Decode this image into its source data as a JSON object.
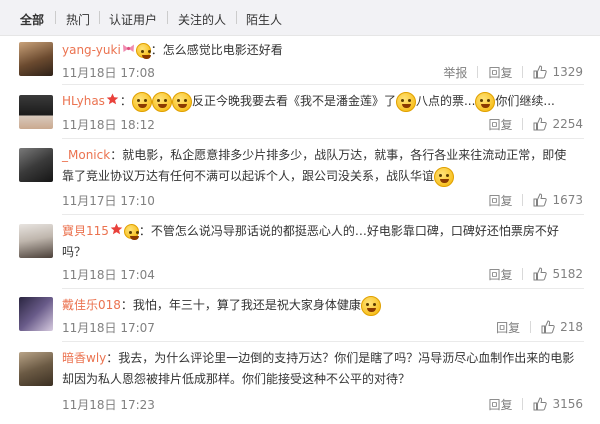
{
  "tabs": [
    "全部",
    "热门",
    "认证用户",
    "关注的人",
    "陌生人"
  ],
  "actions": {
    "report_label": "举报",
    "reply_label": "回复"
  },
  "comments": [
    {
      "user": "yang-yuki",
      "badge": "bow-icon",
      "segments": [
        "：怎么感觉比电影还好看"
      ],
      "time": "11月18日 17:08",
      "likes": "1329",
      "show_report": true
    },
    {
      "user": "HLyhas",
      "badge": "star-icon",
      "segments": [
        "：",
        "反正今晚我要去看《我不是潘金莲》了",
        "八点的票...",
        "你们继续..."
      ],
      "time": "11月18日 18:12",
      "likes": "2254",
      "show_report": false
    },
    {
      "user": "_Monick",
      "badge": "",
      "segments": [
        "：就电影，私企愿意排多少片排多少，战队万达，就事，各行各业来往流动正常，即使靠了竞业协议万达有任何不满可以起诉个人，跟公司没关系，战队华谊"
      ],
      "time": "11月17日 17:10",
      "likes": "1673",
      "show_report": false
    },
    {
      "user": "寶貝115",
      "badge": "star-icon",
      "segments": [
        "：不管怎么说冯导那话说的都挺恶心人的…好电影靠口碑，口碑好还怕票房不好吗？"
      ],
      "time": "11月18日 17:04",
      "likes": "5182",
      "show_report": false
    },
    {
      "user": "戴佳乐018",
      "badge": "",
      "segments": [
        "：我怕，年三十，算了我还是祝大家身体健康"
      ],
      "time": "11月18日 17:07",
      "likes": "218",
      "show_report": false
    },
    {
      "user": "暗香wly",
      "badge": "",
      "segments": [
        "：我去，为什么评论里一边倒的支持万达？你们是瞎了吗？冯导沥尽心血制作出来的电影却因为私人恩怨被排片低成那样。你们能接受这种不公平的对待？"
      ],
      "time": "11月18日 17:23",
      "likes": "3156",
      "show_report": false
    }
  ],
  "colors": {
    "username": "#eb7350",
    "meta": "#808080",
    "tabs_bg": "#f2f2f5"
  }
}
